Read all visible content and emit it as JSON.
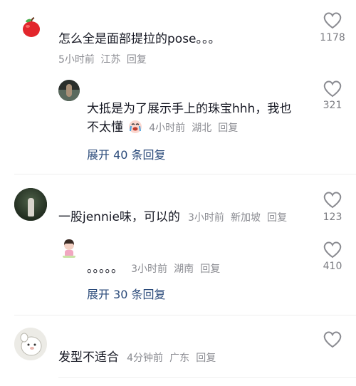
{
  "comments": [
    {
      "text": "怎么全是面部提拉的pose。。。",
      "time": "5小时前",
      "location": "江苏",
      "reply_label": "回复",
      "likes": "1178",
      "avatar_icon": "apple-emoji-icon"
    },
    {
      "text_line1": "大抵是为了展示手上的珠宝hhh，我也",
      "text_line2": "不太懂",
      "time": "4小时前",
      "location": "湖北",
      "reply_label": "回复",
      "likes": "321",
      "emoji": "crying-face-icon",
      "expand": "展开 40 条回复"
    },
    {
      "text": "一股jennie味，可以的",
      "time": "3小时前",
      "location": "新加坡",
      "reply_label": "回复",
      "likes": "123"
    },
    {
      "text": "。。。。。",
      "time": "3小时前",
      "location": "湖南",
      "reply_label": "回复",
      "likes": "410",
      "expand": "展开 30 条回复"
    },
    {
      "text": "发型不适合",
      "time": "4分钟前",
      "location": "广东",
      "reply_label": "回复"
    }
  ],
  "colors": {
    "text": "#161823",
    "meta": "#8a8b91",
    "expand": "#2a4a7a",
    "apple": "#e2262c"
  }
}
